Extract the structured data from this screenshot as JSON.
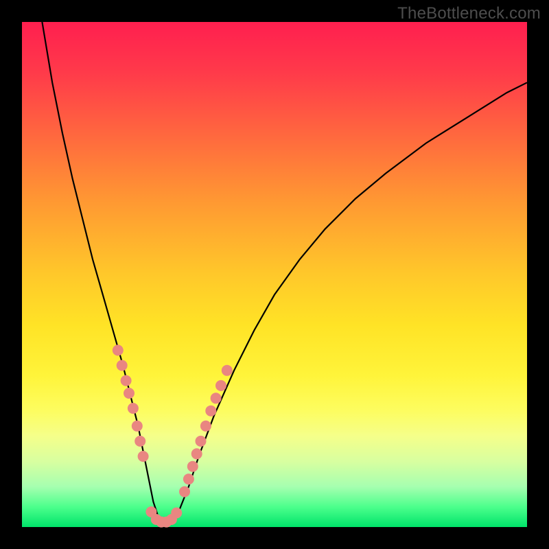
{
  "watermark": "TheBottleneck.com",
  "colors": {
    "frame": "#000000",
    "dot": "#e98681",
    "curve": "#000000",
    "gradient_top": "#ff1f4f",
    "gradient_bottom": "#00e46a"
  },
  "chart_data": {
    "type": "line",
    "title": "",
    "xlabel": "",
    "ylabel": "",
    "xlim": [
      0,
      100
    ],
    "ylim": [
      0,
      100
    ],
    "series": [
      {
        "name": "bottleneck-curve",
        "x": [
          4,
          6,
          8,
          10,
          12,
          14,
          16,
          18,
          20,
          22,
          23,
          24,
          25,
          26,
          27,
          28,
          29,
          30,
          31,
          33,
          35,
          38,
          42,
          46,
          50,
          55,
          60,
          66,
          72,
          80,
          88,
          96,
          100
        ],
        "y": [
          100,
          88,
          78,
          69,
          61,
          53,
          46,
          39,
          32,
          24,
          20,
          15,
          10,
          5,
          2,
          1,
          1,
          1,
          3,
          8,
          14,
          22,
          31,
          39,
          46,
          53,
          59,
          65,
          70,
          76,
          81,
          86,
          88
        ]
      }
    ],
    "marker_clusters": [
      {
        "name": "left-descent-dots",
        "points": [
          {
            "x": 19.0,
            "y": 35.0
          },
          {
            "x": 19.8,
            "y": 32.0
          },
          {
            "x": 20.6,
            "y": 29.0
          },
          {
            "x": 21.2,
            "y": 26.5
          },
          {
            "x": 22.0,
            "y": 23.5
          },
          {
            "x": 22.8,
            "y": 20.0
          },
          {
            "x": 23.4,
            "y": 17.0
          },
          {
            "x": 24.0,
            "y": 14.0
          }
        ]
      },
      {
        "name": "trough-dots",
        "points": [
          {
            "x": 25.6,
            "y": 3.0
          },
          {
            "x": 26.6,
            "y": 1.5
          },
          {
            "x": 27.6,
            "y": 1.0
          },
          {
            "x": 28.6,
            "y": 1.0
          },
          {
            "x": 29.6,
            "y": 1.5
          },
          {
            "x": 30.6,
            "y": 2.8
          }
        ]
      },
      {
        "name": "right-ascent-dots",
        "points": [
          {
            "x": 32.2,
            "y": 7.0
          },
          {
            "x": 33.0,
            "y": 9.5
          },
          {
            "x": 33.8,
            "y": 12.0
          },
          {
            "x": 34.6,
            "y": 14.5
          },
          {
            "x": 35.4,
            "y": 17.0
          },
          {
            "x": 36.4,
            "y": 20.0
          },
          {
            "x": 37.4,
            "y": 23.0
          },
          {
            "x": 38.4,
            "y": 25.5
          },
          {
            "x": 39.4,
            "y": 28.0
          },
          {
            "x": 40.6,
            "y": 31.0
          }
        ]
      }
    ]
  }
}
